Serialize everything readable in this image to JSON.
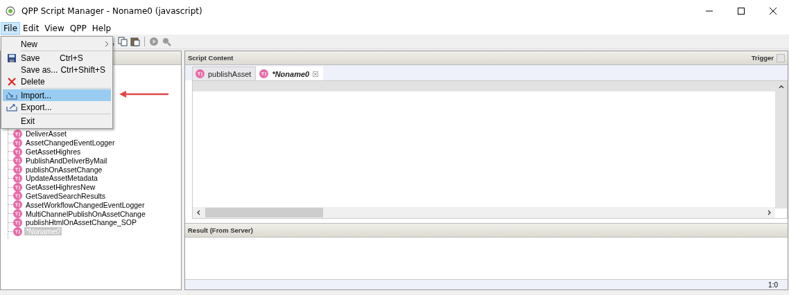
{
  "window": {
    "title": "QPP Script Manager - Noname0 (javascript)"
  },
  "menubar": [
    {
      "label": "File",
      "selected": true
    },
    {
      "label": "Edit",
      "selected": false
    },
    {
      "label": "View",
      "selected": false
    },
    {
      "label": "QPP",
      "selected": false
    },
    {
      "label": "Help",
      "selected": false
    }
  ],
  "file_menu": [
    {
      "kind": "submenu",
      "label": "New",
      "selected": false
    },
    {
      "kind": "separator"
    },
    {
      "kind": "save",
      "label": "Save",
      "shortcut": "Ctrl+S",
      "selected": false
    },
    {
      "kind": "plain",
      "label": "Save as...",
      "shortcut": "Ctrl+Shift+S",
      "selected": false
    },
    {
      "kind": "delete",
      "label": "Delete",
      "selected": false
    },
    {
      "kind": "separator"
    },
    {
      "kind": "import",
      "label": "Import...",
      "selected": true
    },
    {
      "kind": "export",
      "label": "Export...",
      "selected": false
    },
    {
      "kind": "separator"
    },
    {
      "kind": "plain",
      "label": "Exit",
      "selected": false
    }
  ],
  "tree": [
    {
      "label": "DeliverAsset",
      "selected": false,
      "modified": false
    },
    {
      "label": "AssetChangedEventLogger",
      "selected": false,
      "modified": false
    },
    {
      "label": "GetAssetHighres",
      "selected": false,
      "modified": false
    },
    {
      "label": "PublishAndDeliverByMail",
      "selected": false,
      "modified": false
    },
    {
      "label": "publishOnAssetChange",
      "selected": false,
      "modified": false
    },
    {
      "label": "UpdateAssetMetadata",
      "selected": false,
      "modified": false
    },
    {
      "label": "GetAssetHighresNew",
      "selected": false,
      "modified": false
    },
    {
      "label": "GetSavedSearchResults",
      "selected": false,
      "modified": false
    },
    {
      "label": "AssetWorkflowChangedEventLogger",
      "selected": false,
      "modified": false
    },
    {
      "label": "MultiChannelPublishOnAssetChange",
      "selected": false,
      "modified": false
    },
    {
      "label": "publishHtmlOnAssetChange_SOP",
      "selected": false,
      "modified": false
    },
    {
      "label": "*Noname0",
      "selected": true,
      "modified": true
    }
  ],
  "script_panel": {
    "title": "Script Content",
    "trigger_label": "Trigger",
    "tabs": [
      {
        "label": "publishAsset",
        "selected": false
      },
      {
        "label": "*Noname0",
        "selected": true
      }
    ]
  },
  "result_panel": {
    "title": "Result (From Server)"
  },
  "status_bar": {
    "position": "1:0"
  }
}
